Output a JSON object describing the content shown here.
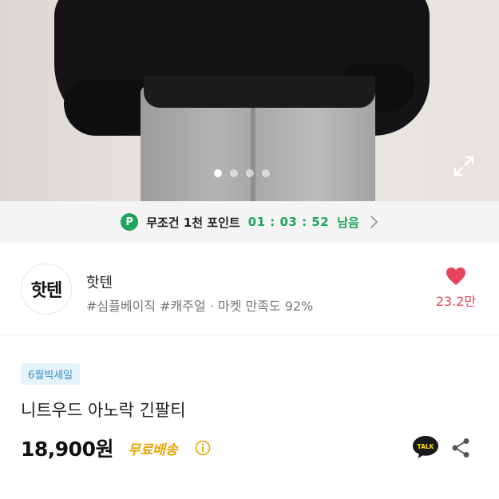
{
  "hero": {
    "slide_count": 4,
    "active_slide": 1
  },
  "icons": {
    "expand": "expand-arrows-icon",
    "points": "p-points-icon",
    "chevron": "chevron-right-icon",
    "heart": "heart-icon",
    "info": "info-circle-icon",
    "talk": "kakao-talk-icon",
    "share": "share-icon"
  },
  "points_banner": {
    "badge": "P",
    "label": "무조건 1천 포인트",
    "timer": "01 : 03 : 52",
    "suffix": "남음"
  },
  "seller": {
    "logo_text": "핫텐",
    "name": "핫텐",
    "tags": "#심플베이직 #캐주얼 · 마켓 만족도 92%",
    "likes": "23.2만"
  },
  "product": {
    "badge": "6월빅세일",
    "title": "니트우드 아노락 긴팔티",
    "price": "18,900원",
    "shipping": "무료배송"
  },
  "colors": {
    "points_green": "#1ea55a",
    "heart_red": "#e8455b",
    "shipping_orange": "#e6a400",
    "badge_blue": "#2f8fc9",
    "badge_bg": "#e6f3fb",
    "talk_yellow": "#191919"
  }
}
